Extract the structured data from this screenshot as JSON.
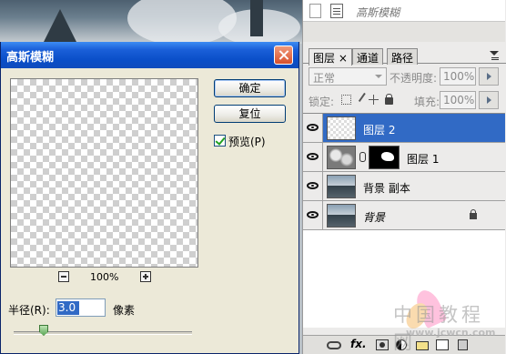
{
  "dialog": {
    "title": "高斯模糊",
    "ok_label": "确定",
    "reset_label": "复位",
    "preview_label": "预览(P)",
    "preview_checked": true,
    "zoom_level": "100%",
    "radius_label": "半径(R):",
    "radius_value": "3.0",
    "radius_unit": "像素"
  },
  "history": {
    "state_name": "高斯模糊"
  },
  "layers_panel": {
    "tabs": [
      {
        "label": "图层"
      },
      {
        "label": "通道"
      },
      {
        "label": "路径"
      }
    ],
    "blend_mode": "正常",
    "opacity_label": "不透明度:",
    "opacity_value": "100%",
    "lock_label": "锁定:",
    "fill_label": "填充:",
    "fill_value": "100%",
    "layers": [
      {
        "name": "图层 2",
        "selected": true
      },
      {
        "name": "图层 1"
      },
      {
        "name": "背景 副本"
      },
      {
        "name": "背景",
        "locked": true
      }
    ],
    "fx_label": "fx."
  },
  "watermark": {
    "text": "中国教程网",
    "url": "www.jcwcn.com"
  }
}
